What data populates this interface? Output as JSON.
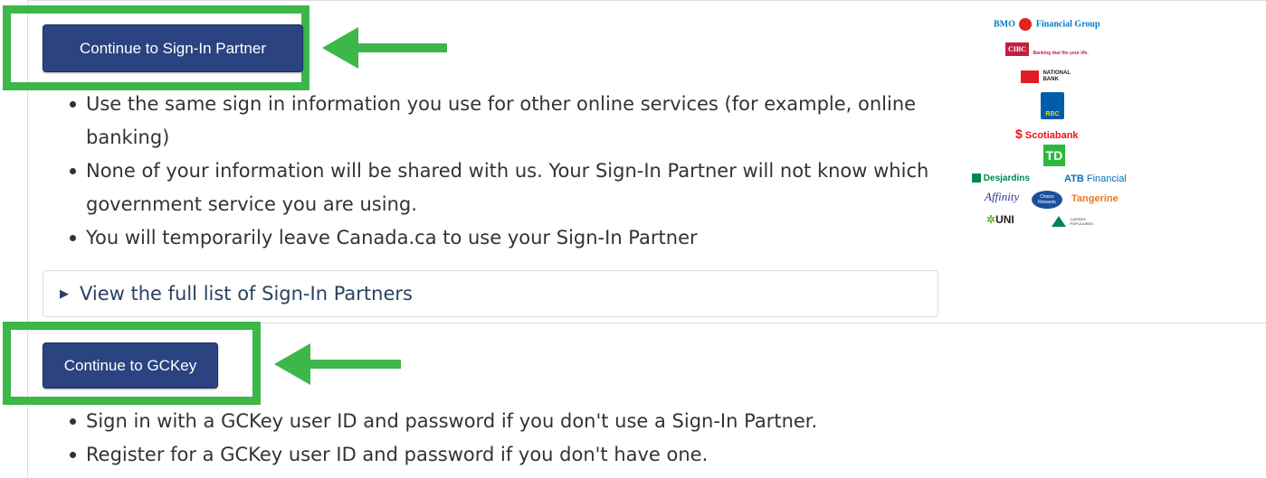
{
  "sign_in_partner": {
    "button_label": "Continue to Sign-In Partner",
    "bullets": [
      "Use the same sign in information you use for other online services (for example, online banking)",
      "None of your information will be shared with us. Your Sign-In Partner will not know which government service you are using.",
      "You will temporarily leave Canada.ca to use your Sign-In Partner"
    ],
    "details_label": "View the full list of Sign-In Partners"
  },
  "gckey": {
    "button_label": "Continue to GCKey",
    "bullets": [
      "Sign in with a GCKey user ID and password if you don't use a Sign-In Partner.",
      "Register for a GCKey user ID and password if you don't have one."
    ]
  },
  "partner_logos": {
    "bmo": "BMO",
    "bmo_suffix": "Financial Group",
    "cibc": "CIBC",
    "cibc_tagline": "Banking that fits your life.",
    "national_bank": "NATIONAL BANK",
    "rbc": "RBC",
    "scotiabank": "Scotiabank",
    "td": "TD",
    "desjardins": "Desjardins",
    "atb": "ATB",
    "atb_suffix": "Financial",
    "affinity": "Affinity",
    "choice_rewards": "Choice Rewards",
    "tangerine": "Tangerine",
    "uni": "UNI",
    "caisses": "CAISSES POPULAIRES"
  },
  "colors": {
    "button_bg": "#2b4380",
    "highlight_green": "#3db64a",
    "link_blue": "#284162"
  }
}
